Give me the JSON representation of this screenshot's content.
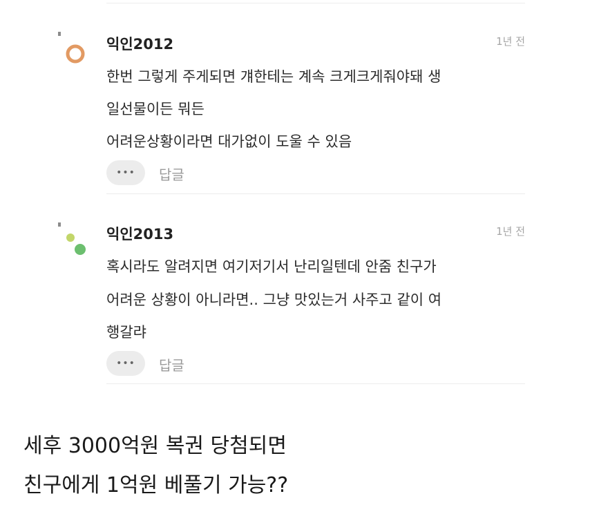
{
  "comments": [
    {
      "username": "익인2012",
      "time": "1년 전",
      "lines": [
        "한번 그렇게 주게되면 걔한테는 계속 크게크게줘야돼 생",
        "일선물이든 뭐든",
        "어려운상황이라면 대가없이 도울 수 있음"
      ],
      "more_label": "•••",
      "reply_label": "답글",
      "avatar_colors": [
        "#e29a63"
      ]
    },
    {
      "username": "익인2013",
      "time": "1년 전",
      "lines": [
        "혹시라도 알려지면 여기저기서 난리일텐데 안줌 친구가",
        "어려운 상황이 아니라면.. 그냥 맛있는거 사주고 같이 여",
        "행갈랴"
      ],
      "more_label": "•••",
      "reply_label": "답글",
      "avatar_colors": [
        "#c2d66a",
        "#6cbf6f"
      ]
    }
  ],
  "caption": {
    "line1": "세후 3000억원 복권 당첨되면",
    "line2": "친구에게 1억원 베풀기 가능??"
  }
}
